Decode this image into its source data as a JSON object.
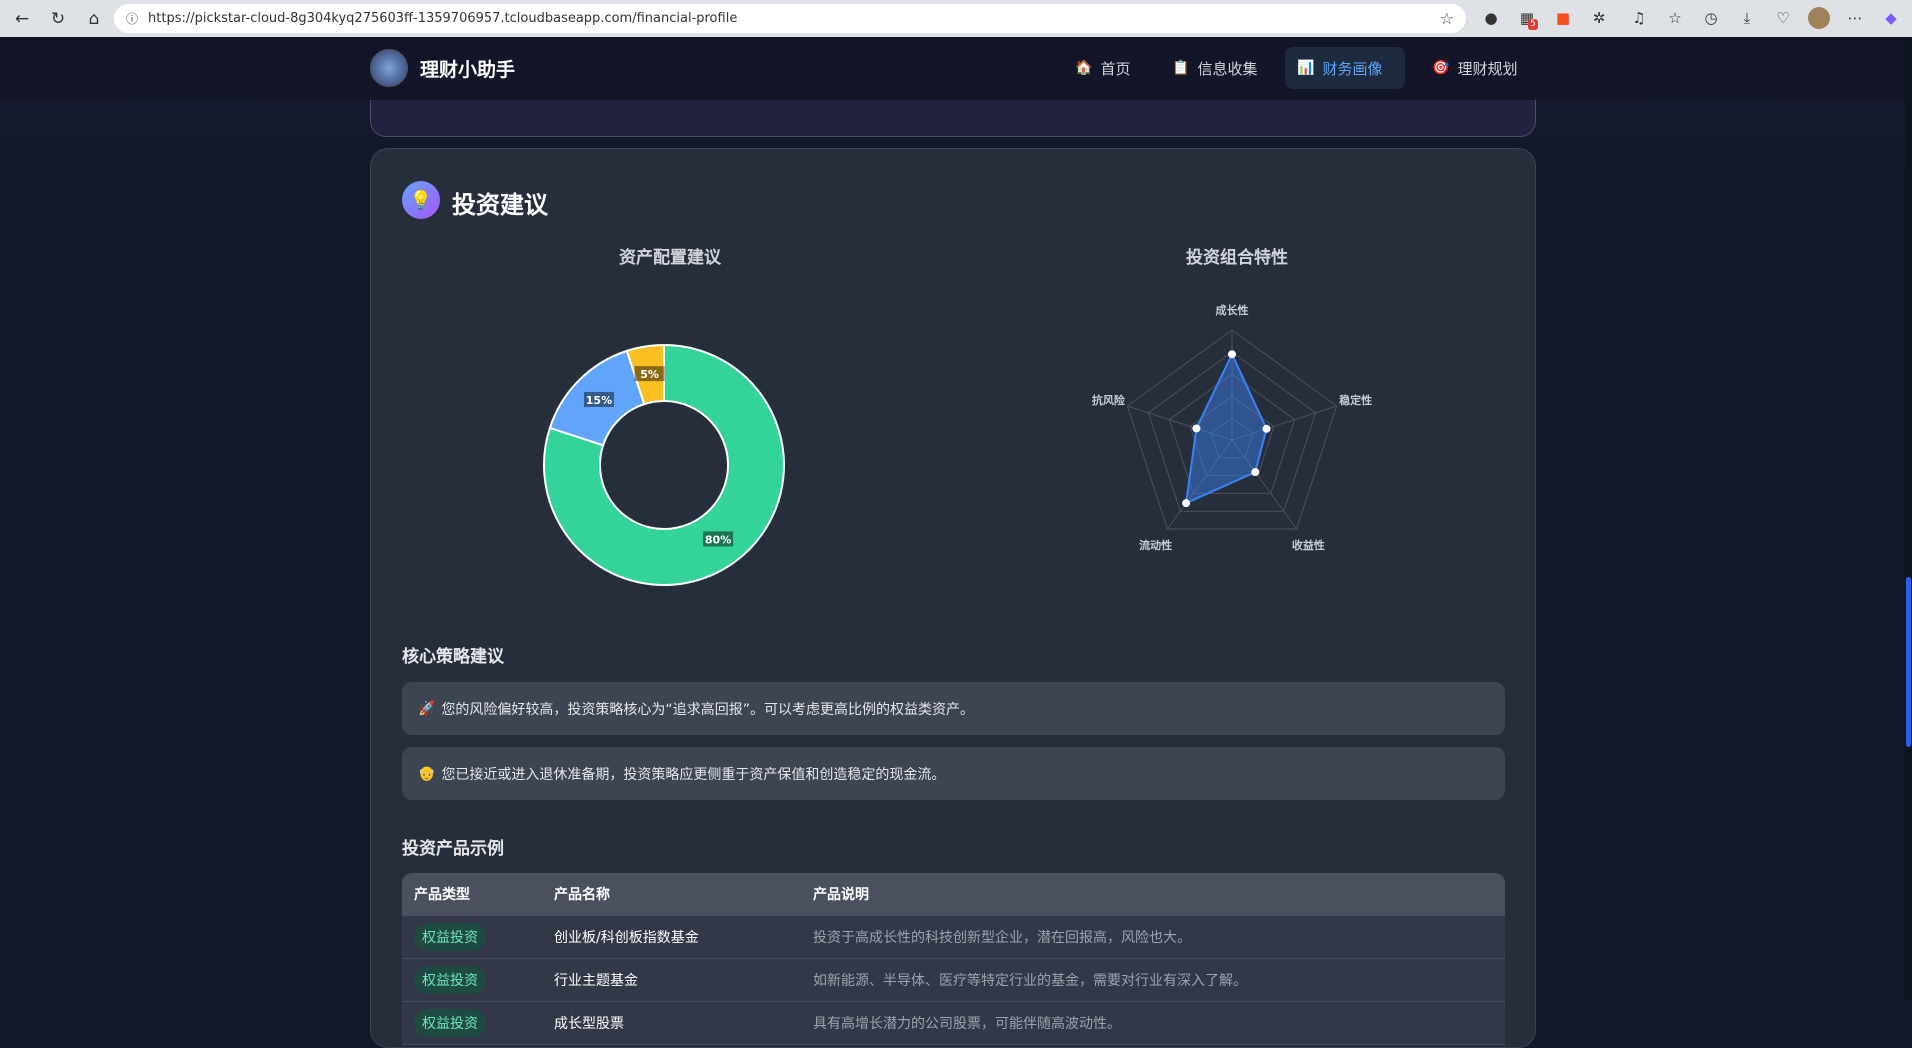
{
  "browser": {
    "url": "https://pickstar-cloud-8g304kyq275603ff-1359706957.tcloudbaseapp.com/financial-profile",
    "ext_badge": "5"
  },
  "nav": {
    "brand": "理财小助手",
    "items": [
      {
        "label": "首页",
        "icon": "house-icon"
      },
      {
        "label": "信息收集",
        "icon": "clipboard-icon"
      },
      {
        "label": "财务画像",
        "icon": "bar-chart-icon",
        "active": true
      },
      {
        "label": "理财规划",
        "icon": "target-icon"
      }
    ]
  },
  "section": {
    "title": "投资建议",
    "icon": "lightbulb-icon"
  },
  "chart_data": [
    {
      "type": "pie",
      "title": "资产配置建议",
      "donut": true,
      "slices": [
        {
          "label": "80%",
          "value": 80,
          "color": "#34d399"
        },
        {
          "label": "15%",
          "value": 15,
          "color": "#60a5fa"
        },
        {
          "label": "5%",
          "value": 5,
          "color": "#fbbf24"
        }
      ]
    },
    {
      "type": "radar",
      "title": "投资组合特性",
      "axes": [
        "成长性",
        "稳定性",
        "收益性",
        "流动性",
        "抗风险"
      ],
      "values": [
        78,
        33,
        36,
        71,
        34
      ],
      "max": 100,
      "rings": 5,
      "color": "#3b82f6"
    }
  ],
  "strategy": {
    "title": "核心策略建议",
    "items": [
      {
        "emoji": "🚀",
        "text": "您的风险偏好较高，投资策略核心为“追求高回报”。可以考虑更高比例的权益类资产。"
      },
      {
        "emoji": "👴",
        "text": "您已接近或进入退休准备期，投资策略应更侧重于资产保值和创造稳定的现金流。"
      }
    ]
  },
  "products": {
    "title": "投资产品示例",
    "headers": [
      "产品类型",
      "产品名称",
      "产品说明"
    ],
    "rows": [
      {
        "type": "权益投资",
        "name": "创业板/科创板指数基金",
        "desc": "投资于高成长性的科技创新型企业，潜在回报高，风险也大。"
      },
      {
        "type": "权益投资",
        "name": "行业主题基金",
        "desc": "如新能源、半导体、医疗等特定行业的基金，需要对行业有深入了解。"
      },
      {
        "type": "权益投资",
        "name": "成长型股票",
        "desc": "具有高增长潜力的公司股票，可能伴随高波动性。"
      }
    ]
  }
}
